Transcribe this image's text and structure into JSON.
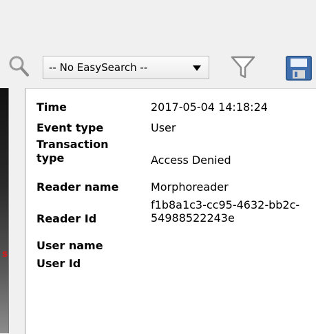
{
  "toolbar": {
    "easysearch": {
      "selected": "-- No EasySearch --"
    },
    "icons": [
      "search-icon",
      "filter-icon",
      "save-icon"
    ]
  },
  "left_panel": {
    "marker": "s"
  },
  "details": {
    "rows": [
      {
        "label": "Time",
        "value": "2017-05-04 14:18:24"
      },
      {
        "label": "Event type",
        "value": "User"
      },
      {
        "label": "Transaction type",
        "value": "Access Denied"
      },
      {
        "label": "Reader name",
        "value": "Morphoreader"
      },
      {
        "label": "Reader Id",
        "value": "f1b8a1c3-cc95-4632-bb2c-54988522243e"
      },
      {
        "label": "User name",
        "value": ""
      },
      {
        "label": "User Id",
        "value": ""
      }
    ]
  },
  "colors": {
    "accent_red": "#d21d1d",
    "save_blue": "#3f6fae"
  }
}
